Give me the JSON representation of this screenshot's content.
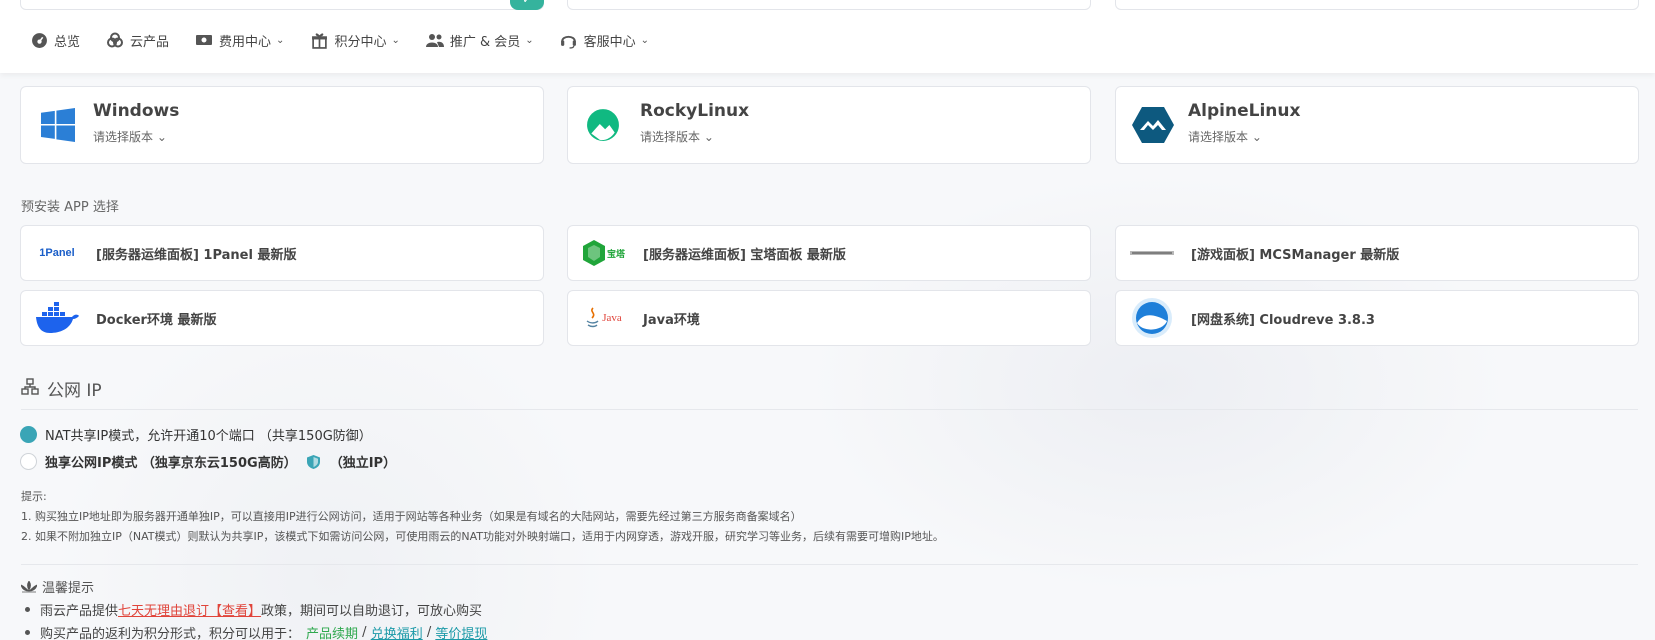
{
  "nav": {
    "items": [
      {
        "label": "总览",
        "icon": "dashboard-icon",
        "dropdown": false
      },
      {
        "label": "云产品",
        "icon": "cloud-products-icon",
        "dropdown": false
      },
      {
        "label": "费用中心",
        "icon": "billing-icon",
        "dropdown": true
      },
      {
        "label": "积分中心",
        "icon": "gift-icon",
        "dropdown": true
      },
      {
        "label": "推广 & 会员",
        "icon": "users-icon",
        "dropdown": true
      },
      {
        "label": "客服中心",
        "icon": "headset-icon",
        "dropdown": true
      }
    ]
  },
  "os": {
    "cards": [
      {
        "name": "Windows",
        "version_placeholder": "请选择版本",
        "icon": "windows-logo-icon"
      },
      {
        "name": "RockyLinux",
        "version_placeholder": "请选择版本",
        "icon": "rockylinux-logo-icon"
      },
      {
        "name": "AlpineLinux",
        "version_placeholder": "请选择版本",
        "icon": "alpinelinux-logo-icon"
      }
    ]
  },
  "apps": {
    "section_label": "预安装 APP 选择",
    "items": [
      {
        "name": "[服务器运维面板] 1Panel 最新版",
        "logo_text": "1Panel",
        "icon": "1panel-logo-icon"
      },
      {
        "name": "[服务器运维面板] 宝塔面板 最新版",
        "logo_text": "宝塔",
        "icon": "baota-logo-icon"
      },
      {
        "name": "[游戏面板] MCSManager 最新版",
        "logo_text": "",
        "icon": "mcsmanager-logo-icon"
      },
      {
        "name": "Docker环境 最新版",
        "logo_text": "",
        "icon": "docker-logo-icon"
      },
      {
        "name": "Java环境",
        "logo_text": "Java",
        "icon": "java-logo-icon"
      },
      {
        "name": "[网盘系统] Cloudreve 3.8.3",
        "logo_text": "",
        "icon": "cloudreve-logo-icon"
      }
    ]
  },
  "public_ip": {
    "title": "公网 IP",
    "options": [
      {
        "label": "NAT共享IP模式，允许开通10个端口 （共享150G防御）",
        "selected": true
      },
      {
        "label": "独享公网IP模式 （独享京东云150G高防）",
        "suffix": "（独立IP）",
        "selected": false
      }
    ],
    "tips_title": "提示:",
    "tips": [
      "1. 购买独立IP地址即为服务器开通单独IP，可以直接用IP进行公网访问，适用于网站等各种业务（如果是有域名的大陆网站，需要先经过第三方服务商备案域名）",
      "2. 如果不附加独立IP（NAT模式）则默认为共享IP，该模式下如需访问公网，可使用雨云的NAT功能对外映射端口，适用于内网穿透，游戏开服，研究学习等业务，后续有需要可增购IP地址。"
    ]
  },
  "warm_tips": {
    "title": "温馨提示",
    "line1_prefix": "雨云产品提供",
    "line1_link": "七天无理由退订【查看】",
    "line1_suffix": "政策，期间可以自助退订，可放心购买",
    "line2_prefix": "购买产品的返利为积分形式，积分可以用于：",
    "line2_green": "产品续期",
    "line2_sep1": " / ",
    "line2_link1": "兑换福利",
    "line2_sep2": " / ",
    "line2_link2": "等价提现"
  },
  "colors": {
    "accent": "#3aa5b6",
    "link_red": "#e0443a",
    "green": "#2fa84f"
  }
}
